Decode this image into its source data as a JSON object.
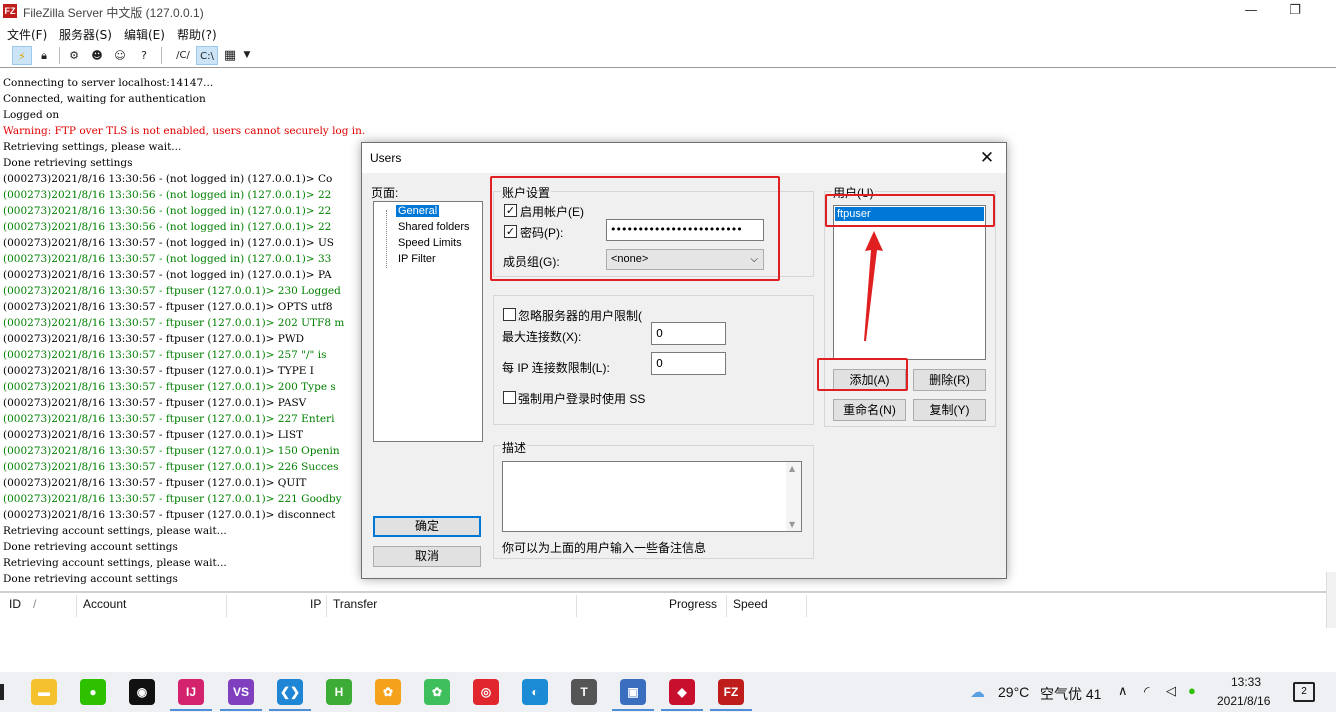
{
  "window": {
    "title": "FileZilla Server 中文版 (127.0.0.1)",
    "icon_text": "FZ",
    "minimize_glyph": "—",
    "restore_glyph": "❐"
  },
  "menu": [
    "文件(F)",
    "服务器(S)",
    "编辑(E)",
    "帮助(?)"
  ],
  "toolbar": {
    "path_btn1": "/C/",
    "path_btn2": "C:\\",
    "help_glyph": "?"
  },
  "log": [
    {
      "text": "Connecting to server localhost:14147...",
      "color": "black"
    },
    {
      "text": "Connected, waiting for authentication",
      "color": "black"
    },
    {
      "text": "Logged on",
      "color": "black"
    },
    {
      "text": "Warning: FTP over TLS is not enabled, users cannot securely log in.",
      "color": "red"
    },
    {
      "text": "Retrieving settings, please wait...",
      "color": "black"
    },
    {
      "text": "Done retrieving settings",
      "color": "black"
    },
    {
      "text": "(000273)2021/8/16 13:30:56 - (not logged in) (127.0.0.1)> Co",
      "color": "black"
    },
    {
      "text": "(000273)2021/8/16 13:30:56 - (not logged in) (127.0.0.1)> 22",
      "color": "green"
    },
    {
      "text": "(000273)2021/8/16 13:30:56 - (not logged in) (127.0.0.1)> 22",
      "color": "green"
    },
    {
      "text": "(000273)2021/8/16 13:30:56 - (not logged in) (127.0.0.1)> 22",
      "color": "green"
    },
    {
      "text": "(000273)2021/8/16 13:30:57 - (not logged in) (127.0.0.1)> US",
      "color": "black"
    },
    {
      "text": "(000273)2021/8/16 13:30:57 - (not logged in) (127.0.0.1)> 33",
      "color": "green"
    },
    {
      "text": "(000273)2021/8/16 13:30:57 - (not logged in) (127.0.0.1)> PA",
      "color": "black"
    },
    {
      "text": "(000273)2021/8/16 13:30:57 - ftpuser (127.0.0.1)> 230 Logged",
      "color": "green"
    },
    {
      "text": "(000273)2021/8/16 13:30:57 - ftpuser (127.0.0.1)> OPTS utf8",
      "color": "black"
    },
    {
      "text": "(000273)2021/8/16 13:30:57 - ftpuser (127.0.0.1)> 202 UTF8 m",
      "color": "green"
    },
    {
      "text": "(000273)2021/8/16 13:30:57 - ftpuser (127.0.0.1)> PWD",
      "color": "black"
    },
    {
      "text": "(000273)2021/8/16 13:30:57 - ftpuser (127.0.0.1)> 257 \"/\" is",
      "color": "green"
    },
    {
      "text": "(000273)2021/8/16 13:30:57 - ftpuser (127.0.0.1)> TYPE I",
      "color": "black"
    },
    {
      "text": "(000273)2021/8/16 13:30:57 - ftpuser (127.0.0.1)> 200 Type s",
      "color": "green"
    },
    {
      "text": "(000273)2021/8/16 13:30:57 - ftpuser (127.0.0.1)> PASV",
      "color": "black"
    },
    {
      "text": "(000273)2021/8/16 13:30:57 - ftpuser (127.0.0.1)> 227 Enteri",
      "color": "green"
    },
    {
      "text": "(000273)2021/8/16 13:30:57 - ftpuser (127.0.0.1)> LIST",
      "color": "black"
    },
    {
      "text": "(000273)2021/8/16 13:30:57 - ftpuser (127.0.0.1)> 150 Openin",
      "color": "green"
    },
    {
      "text": "(000273)2021/8/16 13:30:57 - ftpuser (127.0.0.1)> 226 Succes",
      "color": "green"
    },
    {
      "text": "(000273)2021/8/16 13:30:57 - ftpuser (127.0.0.1)> QUIT",
      "color": "black"
    },
    {
      "text": "(000273)2021/8/16 13:30:57 - ftpuser (127.0.0.1)> 221 Goodby",
      "color": "green"
    },
    {
      "text": "(000273)2021/8/16 13:30:57 - ftpuser (127.0.0.1)> disconnect",
      "color": "black"
    },
    {
      "text": "Retrieving account settings, please wait...",
      "color": "black"
    },
    {
      "text": "Done retrieving account settings",
      "color": "black"
    },
    {
      "text": "Retrieving account settings, please wait...",
      "color": "black"
    },
    {
      "text": "Done retrieving account settings",
      "color": "black"
    }
  ],
  "transfer_table": {
    "columns": [
      "ID",
      "Account",
      "IP",
      "Transfer",
      "Progress",
      "Speed"
    ],
    "sort_glyph": "/"
  },
  "dialog": {
    "title": "Users",
    "close_glyph": "✕",
    "page_label": "页面:",
    "pages": [
      "General",
      "Shared folders",
      "Speed Limits",
      "IP Filter"
    ],
    "ok": "确定",
    "cancel": "取消",
    "account_group": "账户设置",
    "enable_account": "启用帐户(E)",
    "password_label": "密码(P):",
    "password_value": "••••••••••••••••••••••••",
    "group_label": "成员组(G):",
    "group_value": "<none>",
    "bypass_limits": "忽略服务器的用户限制(",
    "max_conn_label": "最大连接数(X):",
    "max_conn_value": "0",
    "per_ip_label": "每 IP 连接数限制(L):",
    "per_ip_value": "0",
    "force_ssl": "强制用户登录时使用 SS",
    "desc_label": "描述",
    "desc_hint": "你可以为上面的用户输入一些备注信息",
    "users_label": "用户(U)",
    "users": [
      "ftpuser"
    ],
    "add": "添加(A)",
    "remove": "删除(R)",
    "rename": "重命名(N)",
    "copy": "复制(Y)",
    "check_glyph": "✓"
  },
  "taskbar": {
    "start_glyph": "▌",
    "apps": [
      {
        "name": "file-explorer",
        "glyph": "▬",
        "color": "#f5c22e"
      },
      {
        "name": "wechat",
        "glyph": "●",
        "color": "#2dc100"
      },
      {
        "name": "qq",
        "glyph": "◉",
        "color": "#111111"
      },
      {
        "name": "jetbrains",
        "glyph": "IJ",
        "color": "#d2236c"
      },
      {
        "name": "visual-studio",
        "glyph": "VS",
        "color": "#7f3fbf"
      },
      {
        "name": "vscode",
        "glyph": "❮❯",
        "color": "#1f86d6"
      },
      {
        "name": "hbuilder",
        "glyph": "H",
        "color": "#3dac37"
      },
      {
        "name": "paw",
        "glyph": "✿",
        "color": "#f4a21c"
      },
      {
        "name": "paw-green",
        "glyph": "✿",
        "color": "#3ebf5c"
      },
      {
        "name": "netease-music",
        "glyph": "◎",
        "color": "#e1272d"
      },
      {
        "name": "edge",
        "glyph": "◐",
        "color": "#1b8bd6"
      },
      {
        "name": "typora",
        "glyph": "T",
        "color": "#555555"
      },
      {
        "name": "remote-desktop",
        "glyph": "▣",
        "color": "#3a6fc0"
      },
      {
        "name": "red-book",
        "glyph": "◆",
        "color": "#c8102e"
      },
      {
        "name": "filezilla",
        "glyph": "FZ",
        "color": "#bf1c1c"
      }
    ],
    "weather_temp": "29°C",
    "air_quality": "空气优 41",
    "tray_chevron": "∧",
    "wifi_glyph": "◜",
    "volume_glyph": "◁",
    "wechat_tray": "●",
    "time": "13:33",
    "date": "2021/8/16",
    "notif_count": "2"
  },
  "colors": {
    "annotation_red": "#e02020",
    "selection_blue": "#0078d7",
    "log_green": "#008000",
    "log_red": "#e00000"
  }
}
